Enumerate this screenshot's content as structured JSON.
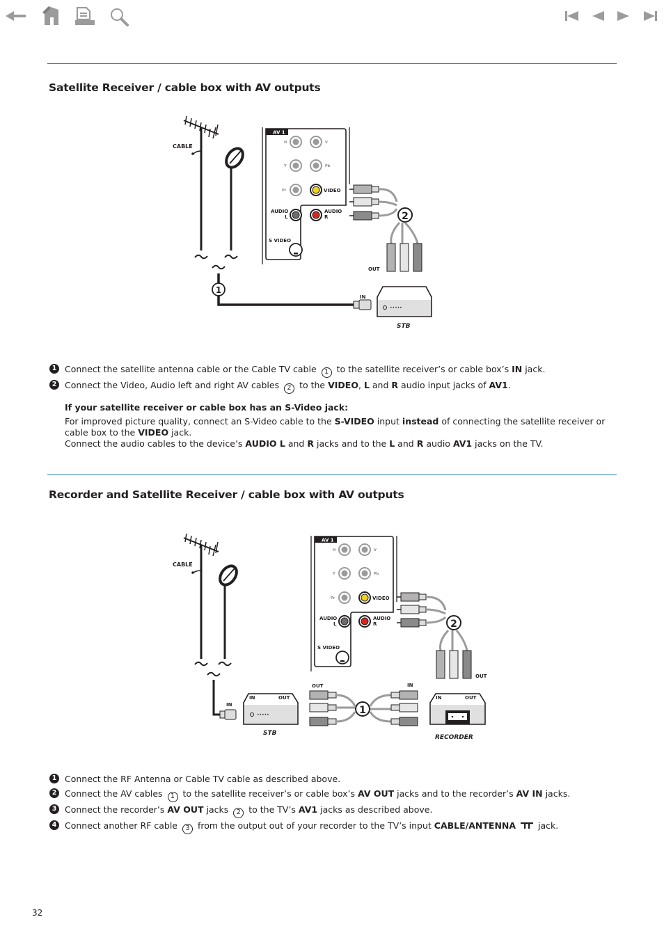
{
  "toolbar": {
    "left": [
      {
        "name": "back-arrow-icon",
        "label": "Back"
      },
      {
        "name": "home-icon",
        "label": "Home"
      },
      {
        "name": "print-icon",
        "label": "Print"
      },
      {
        "name": "search-icon",
        "label": "Search"
      }
    ],
    "right": [
      {
        "name": "first-page-icon",
        "label": "First page"
      },
      {
        "name": "previous-page-icon",
        "label": "Previous page"
      },
      {
        "name": "next-page-icon",
        "label": "Next page"
      },
      {
        "name": "last-page-icon",
        "label": "Last page"
      }
    ],
    "icon_color": "#9b9b9b"
  },
  "colors": {
    "rule": "#1b75b5",
    "text": "#231f20",
    "video_jack": "#f2d21b",
    "audio_r_jack": "#d7261e"
  },
  "section1": {
    "title": "Satellite Receiver / cable box with AV outputs",
    "diagram": {
      "cable_label": "CABLE",
      "panel_label": "AV 1",
      "jacks": {
        "h": "H",
        "v": "V",
        "y": "Y",
        "pb": "Pb",
        "pr": "Pr",
        "video": "VIDEO",
        "audio_l_1": "AUDIO",
        "audio_l_2": "L",
        "audio_r_1": "AUDIO",
        "audio_r_2": "R",
        "s_video": "S VIDEO"
      },
      "out_label": "OUT",
      "in_label": "IN",
      "device_label": "STB",
      "callout_1": "1",
      "callout_2": "2"
    },
    "steps": [
      {
        "num": "1",
        "parts": [
          "Connect the satellite antenna cable or the Cable TV cable",
          "1",
          "to the satellite receiver’s or cable box’s",
          "IN",
          "jack."
        ]
      },
      {
        "num": "2",
        "parts": [
          "Connect the Video, Audio left and right AV cables",
          "2",
          "to the",
          "VIDEO",
          ",",
          "L",
          "and",
          "R",
          "audio input jacks of",
          "AV1",
          "."
        ]
      }
    ],
    "note": {
      "title": "If your satellite receiver or cable box has an S-Video jack:",
      "line1": [
        "For improved picture quality, connect an S-Video cable to the",
        "S-VIDEO",
        "input",
        "instead",
        "of connecting the satellite receiver or cable box to the",
        "VIDEO",
        "jack."
      ],
      "line2": [
        "Connect the audio cables to the device’s",
        "AUDIO L",
        "and",
        "R",
        "jacks and to the",
        "L",
        "and",
        "R",
        "audio",
        "AV1",
        "jacks on the TV."
      ]
    }
  },
  "section2": {
    "title": "Recorder and Satellite Receiver / cable box with AV outputs",
    "diagram": {
      "cable_label": "CABLE",
      "panel_label": "AV 1",
      "jacks": {
        "h": "H",
        "v": "V",
        "y": "Y",
        "pb": "Pb",
        "pr": "Pr",
        "video": "VIDEO",
        "audio_l_1": "AUDIO",
        "audio_l_2": "L",
        "audio_r_1": "AUDIO",
        "audio_r_2": "R",
        "s_video": "S VIDEO"
      },
      "stb_in": "IN",
      "stb_box_in": "IN",
      "stb_box_out": "OUT",
      "stb_label": "STB",
      "av_out_label": "OUT",
      "av_in_label": "IN",
      "rec_box_in": "IN",
      "rec_box_out": "OUT",
      "rec_out_label": "OUT",
      "recorder_label": "RECORDER",
      "callout_1": "1",
      "callout_2": "2"
    },
    "steps": [
      {
        "num": "1",
        "parts": [
          "Connect the RF Antenna or Cable TV cable as described above."
        ]
      },
      {
        "num": "2",
        "parts": [
          "Connect the AV cables",
          "1",
          "to the satellite receiver’s or cable box’s",
          "AV OUT",
          "jacks and to the recorder’s",
          "AV IN",
          "jacks."
        ]
      },
      {
        "num": "3",
        "parts": [
          "Connect the recorder’s",
          "AV OUT",
          "jacks",
          "2",
          "to the TV’s",
          "AV1",
          "jacks as described above."
        ]
      },
      {
        "num": "4",
        "parts": [
          "Connect another RF cable",
          "3",
          "from the output out of your recorder to the TV’s input",
          "CABLE/ANTENNA",
          "jack."
        ]
      }
    ]
  },
  "footer": {
    "page_number": "32"
  }
}
